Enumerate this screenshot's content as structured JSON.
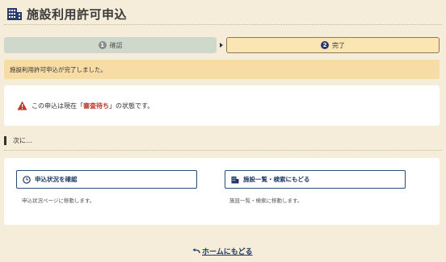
{
  "header": {
    "title": "施設利用許可申込",
    "icon": "building-icon"
  },
  "steps": [
    {
      "number": "1",
      "label": "確認",
      "state": "done"
    },
    {
      "number": "2",
      "label": "完了",
      "state": "active"
    }
  ],
  "banner": {
    "message": "施設利用許可申込が完了しました。"
  },
  "status": {
    "prefix": "この申込は現在「",
    "highlight": "審査待ち",
    "suffix": "」の状態です。",
    "icon": "warning-icon",
    "highlight_color": "#c0392b"
  },
  "next": {
    "heading": "次に…",
    "actions": [
      {
        "label": "申込状況を確認",
        "icon": "clock-icon",
        "description": "申込状況ページに移動します。"
      },
      {
        "label": "施設一覧・検索にもどる",
        "icon": "building-icon",
        "description": "施設一覧・検索に移動します。"
      }
    ]
  },
  "footer": {
    "home_label": "ホームにもどる",
    "icon": "return-arrow-icon"
  },
  "colors": {
    "accent": "#1f3a66",
    "background": "#f5edd9",
    "banner": "#f8dca6",
    "warning": "#c0392b"
  }
}
